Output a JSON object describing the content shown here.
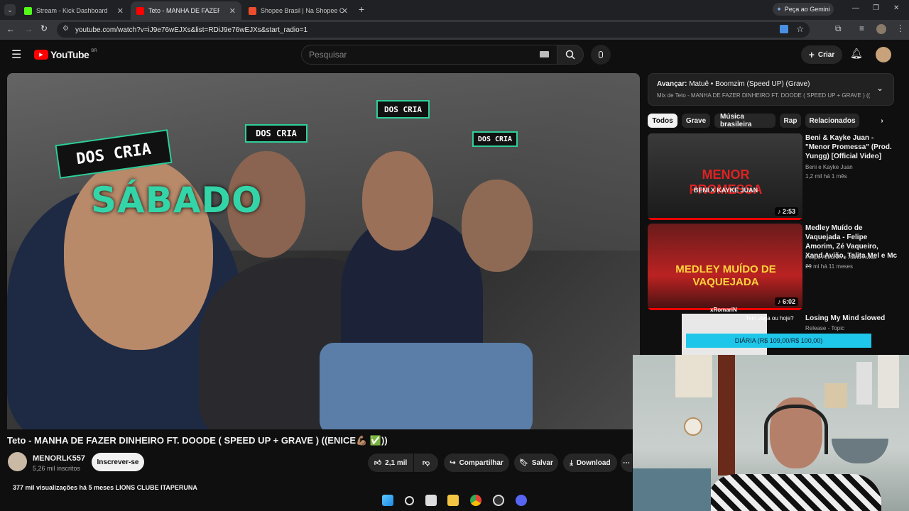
{
  "browser": {
    "tabs": [
      {
        "label": "Stream - Kick Dashboard",
        "color": "#53fc18"
      },
      {
        "label": "Teto - MANHA DE FAZER DI",
        "color": "#ff0000"
      },
      {
        "label": "Shopee Brasil | Na Shopee Com",
        "color": "#ee4d2d"
      }
    ],
    "gemini_label": "Peça ao Gemini",
    "url": "youtube.com/watch?v=iJ9e76wEJXs&list=RDiJ9e76wEJXs&start_radio=1"
  },
  "youtube": {
    "logo_text": "YouTube",
    "country_code": "BR",
    "search_placeholder": "Pesquisar",
    "create_label": "Criar"
  },
  "video": {
    "overlay_text": "SÁBADO",
    "sticker_text": "DOS CRIA",
    "title": "Teto - MANHA DE FAZER DINHEIRO FT. DOODE ( SPEED UP + GRAVE ) ((ENICE💪🏽 ✅))",
    "channel": "MENORLK557",
    "subscribers": "5,26 mil inscritos",
    "subscribe_label": "Inscrever-se",
    "likes": "2,1 mil",
    "share_label": "Compartilhar",
    "save_label": "Salvar",
    "download_label": "Download",
    "views_line": "377 mil visualizações  há 5 meses  LIONS CLUBE ITAPERUNA"
  },
  "playlist": {
    "next_label": "Avançar:",
    "next_title": "Matuê • Boomzim (Speed UP) (Grave)",
    "mix_line": "Mix de Teto - MANHA DE FAZER DINHEIRO FT. DOODE ( SPEED UP + GRAVE ) ((ENI..."
  },
  "chips": [
    "Todos",
    "Grave",
    "Música brasileira",
    "Rap",
    "Relacionados"
  ],
  "recommended": [
    {
      "title": "Beni & Kayke Juan - \"Menor Promessa\" (Prod. Yungg) [Official Video]",
      "channel": "Beni  e Kayke Juan",
      "meta": "1,2 mil  há 1 mês",
      "duration": "2:53",
      "thumb_text": "MENOR PROMESSA",
      "thumb_sub": "BENI X KAYKE JUAN"
    },
    {
      "title": "Medley Muído de Vaquejada - Felipe Amorim, Zé Vaqueiro, Xand Avião, Talita Mel e Mc ...",
      "channel": "Felipe Amorim  e Xand Avião",
      "meta": "29 mi  há 11 meses",
      "duration": "6:02",
      "thumb_text": "MEDLEY MUÍDO DE VAQUEJADA"
    },
    {
      "title": "Losing My Mind slowed",
      "channel": "Release - Topic",
      "meta": ""
    }
  ],
  "stream_overlay": {
    "chat_user": "xRomariN",
    "chat_msg": "Tem vaga ou hoje?",
    "banner": "DIÁRIA (R$ 109,00/R$ 100,00)"
  },
  "colors": {
    "yt_red": "#ff0000",
    "accent_green": "#33d5a8",
    "bg": "#0f0f0f"
  }
}
